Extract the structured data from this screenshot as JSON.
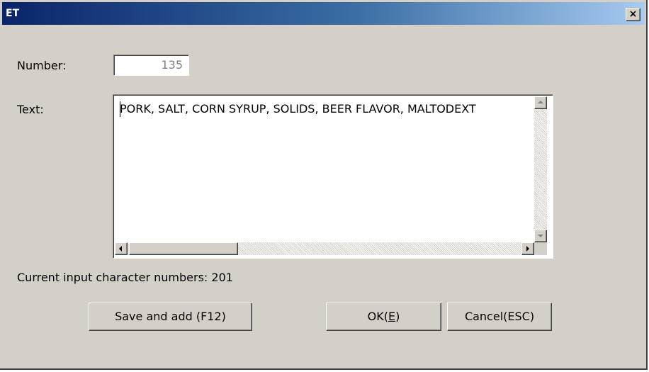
{
  "window": {
    "title": "ET",
    "close_label": "×"
  },
  "form": {
    "number_label": "Number:",
    "number_value": "135",
    "text_label": "Text:",
    "text_value": "PORK, SALT, CORN SYRUP, SOLIDS, BEER FLAVOR, MALTODEXT",
    "char_count_text": "Current input character numbers: 201"
  },
  "buttons": {
    "save_add_label": "Save and add (F12)",
    "ok_prefix": "OK(",
    "ok_mnemonic": "E",
    "ok_suffix": ")",
    "cancel_label": "Cancel(ESC)"
  },
  "colors": {
    "title_bar_start": "#0a246a",
    "title_bar_end": "#a6caf0",
    "dialog_face": "#d4d0c8",
    "field_background": "#ffffff",
    "disabled_text": "#808080"
  },
  "icons": {
    "close": "close-icon",
    "scroll_up": "arrow-up-icon",
    "scroll_down": "arrow-down-icon",
    "scroll_left": "arrow-left-icon",
    "scroll_right": "arrow-right-icon"
  }
}
